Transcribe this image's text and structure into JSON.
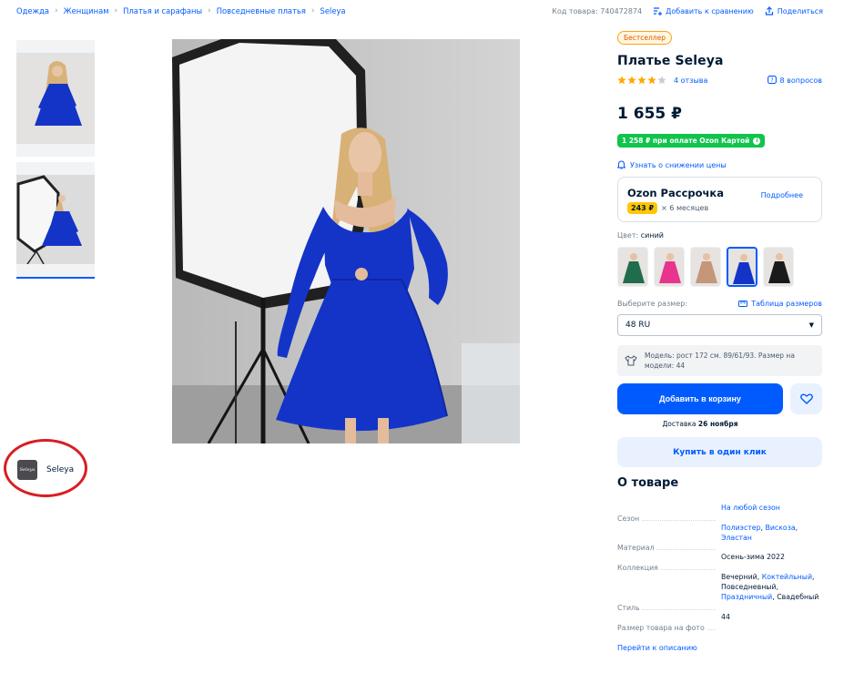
{
  "breadcrumbs": [
    "Одежда",
    "Женщинам",
    "Платья и сарафаны",
    "Повседневные платья",
    "Seleya"
  ],
  "header": {
    "sku": "Код товара: 740472874",
    "compare_label": "Добавить к сравнению",
    "share_label": "Поделиться"
  },
  "seller": {
    "logo_text": "Seleya",
    "name": "Seleya"
  },
  "product": {
    "badge": "Бестселлер",
    "title": "Платье Seleya",
    "rating": 4,
    "reviews": "4 отзыва",
    "questions": "8 вопросов",
    "price": "1 655 ₽",
    "card_price": "1 258 ₽ при оплате Ozon Картой",
    "price_alert": "Узнать о снижении цены"
  },
  "installments": {
    "title": "Ozon Рассрочка",
    "amount": "243 ₽",
    "term": "× 6 месяцев",
    "more": "Подробнее"
  },
  "color": {
    "label": "Цвет:",
    "value": "синий",
    "swatches": [
      "#1f6d4d",
      "#e8348c",
      "#c4967a",
      "#1434c8",
      "#1a1a1a"
    ],
    "selected_index": 3
  },
  "size": {
    "label": "Выберите размер:",
    "chart_link": "Таблица размеров",
    "selected": "48 RU",
    "model_note_line1": "Модель: рост 172 см. 89/61/93. Размер на",
    "model_note_line2": "модели: 44"
  },
  "actions": {
    "add_to_cart": "Добавить в корзину",
    "delivery_prefix": "Доставка",
    "delivery_date": "26 ноября",
    "one_click": "Купить в один клик"
  },
  "about": {
    "title": "О товаре",
    "specs": [
      {
        "key": "Сезон",
        "value_lines": [
          [
            {
              "t": "На любой сезон",
              "link": true
            }
          ]
        ]
      },
      {
        "key": "Материал",
        "value_lines": [
          [
            {
              "t": "Полиэстер",
              "link": true
            },
            {
              "t": ", ",
              "link": false
            },
            {
              "t": "Вискоза",
              "link": true
            },
            {
              "t": ",",
              "link": false
            }
          ],
          [
            {
              "t": "Эластан",
              "link": true
            }
          ]
        ]
      },
      {
        "key": "Коллекция",
        "value_lines": [
          [
            {
              "t": "Осень-зима 2022",
              "link": false
            }
          ]
        ]
      },
      {
        "key": "Стиль",
        "value_lines": [
          [
            {
              "t": "Вечерний, ",
              "link": false
            },
            {
              "t": "Коктейльный",
              "link": true
            },
            {
              "t": ",",
              "link": false
            }
          ],
          [
            {
              "t": "Повседневный,",
              "link": false
            }
          ],
          [
            {
              "t": "Праздничный",
              "link": true
            },
            {
              "t": ", Свадебный",
              "link": false
            }
          ]
        ]
      },
      {
        "key": "Размер товара на фото",
        "value_lines": [
          [
            {
              "t": "44",
              "link": false
            }
          ]
        ]
      }
    ],
    "to_description": "Перейти к описанию"
  },
  "colors": {
    "accent": "#005bff",
    "green": "#10c44c",
    "dress": "#1434c8",
    "highlight_ring": "#d81e24"
  }
}
